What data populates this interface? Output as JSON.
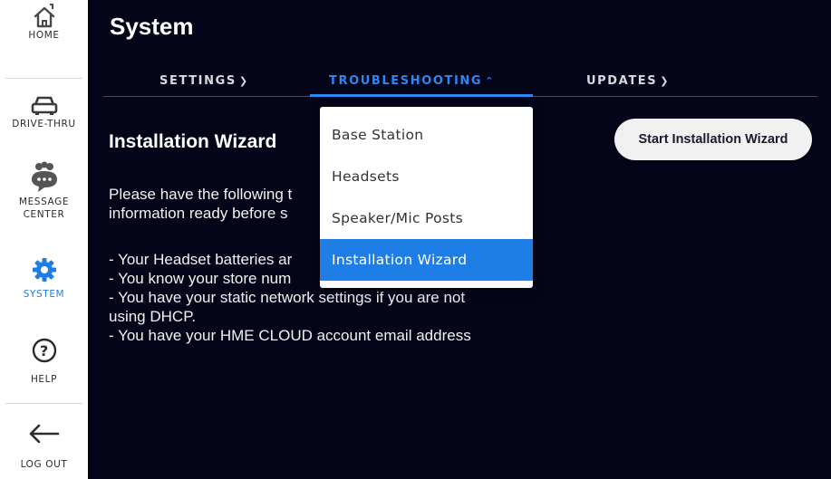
{
  "sidebar": {
    "items": [
      {
        "label": "HOME",
        "icon": "home-icon"
      },
      {
        "label": "DRIVE-THRU",
        "icon": "car-icon"
      },
      {
        "label": "MESSAGE CENTER",
        "icon": "message-center-icon"
      },
      {
        "label": "SYSTEM",
        "icon": "gear-icon",
        "active": true
      },
      {
        "label": "HELP",
        "icon": "help-icon"
      },
      {
        "label": "LOG OUT",
        "icon": "arrow-left-icon"
      }
    ]
  },
  "header": {
    "title": "System"
  },
  "tabs": [
    {
      "label": "SETTINGS",
      "chevron": "down"
    },
    {
      "label": "TROUBLESHOOTING",
      "chevron": "up",
      "active": true
    },
    {
      "label": "UPDATES",
      "chevron": "down"
    }
  ],
  "main": {
    "heading": "Installation Wizard",
    "intro_line1": "Please have the following t",
    "intro_line2": "information ready before s",
    "bullets": [
      "- Your Headset batteries ar",
      "- You know your store num",
      "- You have your static network settings if you are not",
      "using DHCP.",
      "- You have your HME CLOUD account email address"
    ],
    "start_button": "Start Installation Wizard"
  },
  "dropdown": {
    "items": [
      "Base Station",
      "Headsets",
      "Speaker/Mic Posts",
      "Installation Wizard"
    ],
    "selected": "Installation Wizard"
  },
  "colors": {
    "background": "#05051a",
    "accent": "#1e7ee6",
    "active_tab": "#2e86f0"
  }
}
